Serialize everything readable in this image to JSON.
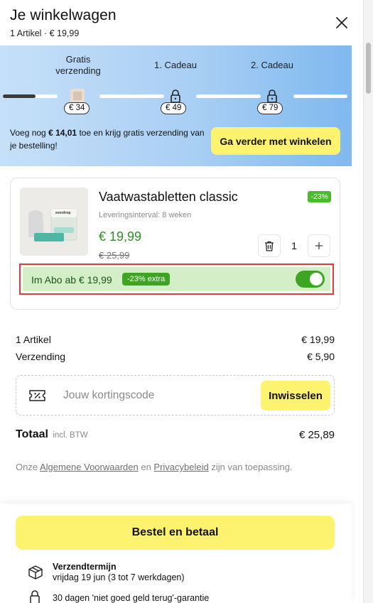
{
  "header": {
    "title": "Je winkelwagen",
    "subtitle": "1 Artikel · € 19,99"
  },
  "progress": {
    "steps": [
      {
        "label": "Gratis verzending",
        "price": "€ 34",
        "fill": 0.6
      },
      {
        "label": "1. Cadeau",
        "price": "€ 49",
        "fill": 0
      },
      {
        "label": "2. Cadeau",
        "price": "€ 79",
        "fill": 0
      }
    ],
    "info_prefix": "Voeg nog ",
    "info_amount": "€ 14,01",
    "info_suffix": " toe en krijg gratis verzending van je bestelling!",
    "continue_label": "Ga verder met winkelen"
  },
  "product": {
    "name": "Vaatwastabletten classic",
    "discount_badge": "-23%",
    "interval": "Leveringsinterval: 8 weken",
    "price": "€ 19,99",
    "old_price": "€ 25,99",
    "quantity": "1",
    "image_brand": "everdrop",
    "abo_label": "Im Abo ab € 19,99",
    "abo_badge": "-23% extra",
    "abo_enabled": true
  },
  "summary": {
    "items_label": "1 Artikel",
    "items_value": "€ 19,99",
    "shipping_label": "Verzending",
    "shipping_value": "€ 5,90",
    "coupon_placeholder": "Jouw kortingscode",
    "redeem_label": "Inwisselen",
    "total_label": "Totaal",
    "total_sub": "incl. BTW",
    "total_value": "€ 25,89",
    "terms_prefix": "Onze ",
    "terms_link1": "Algemene Voorwaarden",
    "terms_mid": " en ",
    "terms_link2": "Privacybeleid",
    "terms_suffix": " zijn van toepassing."
  },
  "footer": {
    "order_label": "Bestel en betaal",
    "ship_title": "Verzendtermijn",
    "ship_date": "vrijdag 19 jun (3 tot 7 werkdagen)",
    "guarantee": "30 dagen 'niet goed geld terug'-garantie"
  },
  "colors": {
    "accent_yellow": "#fdf36e",
    "price_green": "#2f8f25",
    "badge_green": "#4bbb2c",
    "abo_bg": "#d4efc7",
    "highlight_red": "#e03b3b"
  }
}
